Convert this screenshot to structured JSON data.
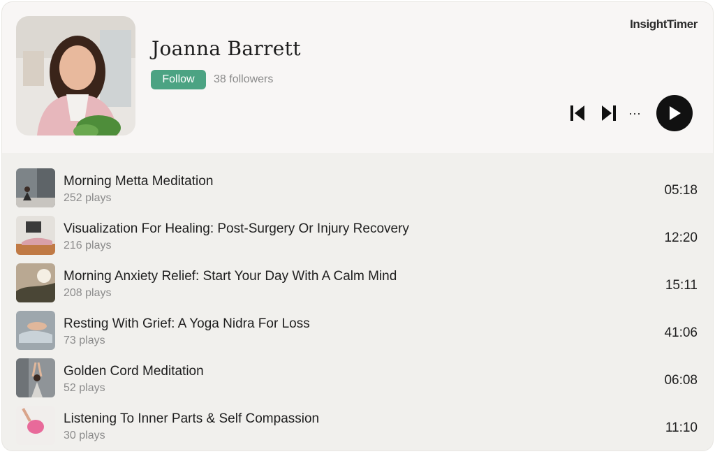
{
  "header": {
    "name": "Joanna Barrett",
    "follow_label": "Follow",
    "followers": "38 followers",
    "brand": "InsightTimer"
  },
  "controls": {
    "previous_icon": "skip-previous-icon",
    "next_icon": "skip-next-icon",
    "more_label": "···",
    "play_icon": "play-icon"
  },
  "colors": {
    "accent": "#4ca383",
    "header_bg": "#f8f6f5",
    "list_bg": "#f1f0ed",
    "play_bg": "#111111"
  },
  "tracks": [
    {
      "title": "Morning Metta Meditation",
      "plays": "252 plays",
      "duration": "05:18"
    },
    {
      "title": "Visualization For Healing: Post-Surgery Or Injury Recovery",
      "plays": "216 plays",
      "duration": "12:20"
    },
    {
      "title": "Morning Anxiety Relief: Start Your Day With A Calm Mind",
      "plays": "208 plays",
      "duration": "15:11"
    },
    {
      "title": "Resting With Grief: A Yoga Nidra For Loss",
      "plays": "73 plays",
      "duration": "41:06"
    },
    {
      "title": "Golden Cord Meditation",
      "plays": "52 plays",
      "duration": "06:08"
    },
    {
      "title": "Listening To Inner Parts & Self Compassion",
      "plays": "30 plays",
      "duration": "11:10"
    }
  ]
}
